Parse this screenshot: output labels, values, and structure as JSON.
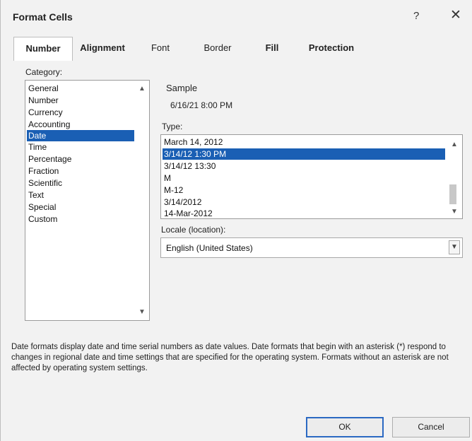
{
  "dialog": {
    "title": "Format Cells",
    "help_label": "?",
    "close_label": "✕"
  },
  "tabs": [
    {
      "label": "Number",
      "active": true
    },
    {
      "label": "Alignment"
    },
    {
      "label": "Font"
    },
    {
      "label": "Border"
    },
    {
      "label": "Fill"
    },
    {
      "label": "Protection"
    }
  ],
  "category": {
    "label": "Category:",
    "items": [
      "General",
      "Number",
      "Currency",
      "Accounting",
      "Date",
      "Time",
      "Percentage",
      "Fraction",
      "Scientific",
      "Text",
      "Special",
      "Custom"
    ],
    "selected": "Date"
  },
  "sample": {
    "label": "Sample",
    "value": "6/16/21 8:00 PM"
  },
  "type": {
    "label": "Type:",
    "items": [
      "March 14, 2012",
      "3/14/12 1:30 PM",
      "3/14/12 13:30",
      "M",
      "M-12",
      "3/14/2012",
      "14-Mar-2012"
    ],
    "selected": "3/14/12 1:30 PM"
  },
  "locale": {
    "label": "Locale (location):",
    "value": "English (United States)"
  },
  "description": "Date formats display date and time serial numbers as date values. Date formats that begin with an asterisk (*) respond to changes in regional date and time settings that are specified for the operating system. Formats without an asterisk are not affected by operating system settings.",
  "buttons": {
    "ok": "OK",
    "cancel": "Cancel"
  },
  "icons": {
    "scroll_up": "▲",
    "scroll_down": "▼",
    "dropdown": "▼"
  },
  "colors": {
    "selection": "#1a5fb4",
    "ok_border": "#2b69c2"
  }
}
